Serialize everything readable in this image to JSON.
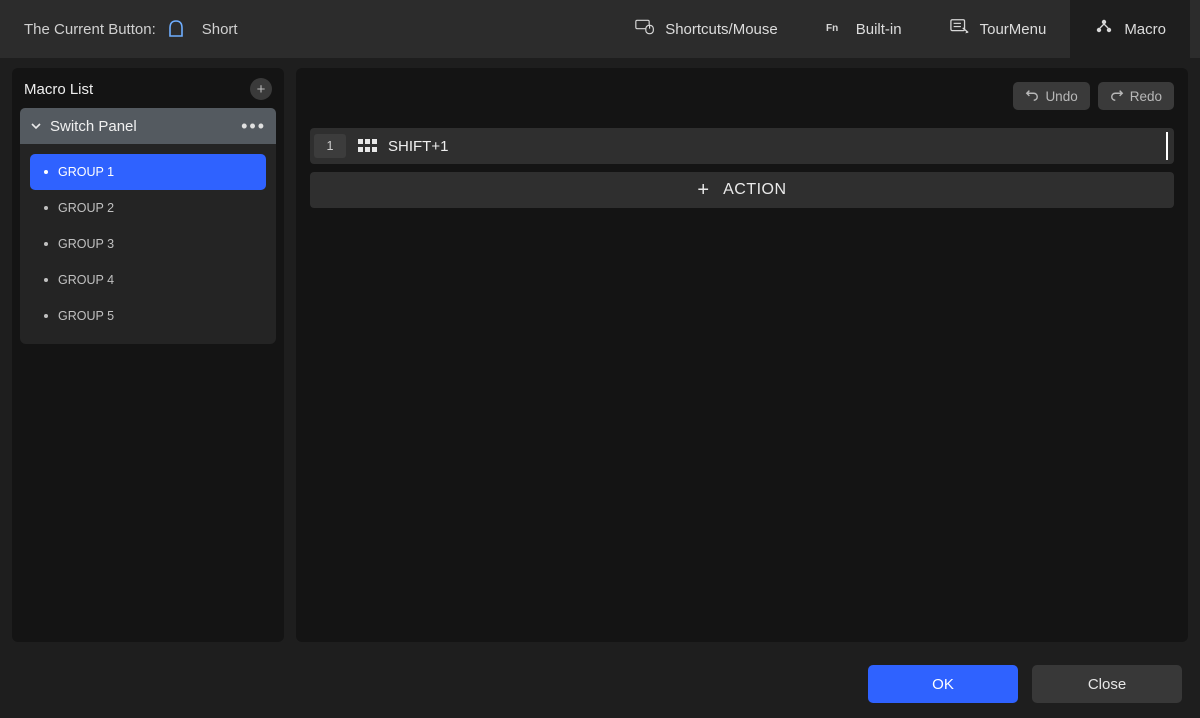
{
  "topbar": {
    "current_button_label": "The Current Button:",
    "current_button_value": "Short"
  },
  "tabs": {
    "shortcuts": "Shortcuts/Mouse",
    "builtin": "Built-in",
    "tourmenu": "TourMenu",
    "macro": "Macro"
  },
  "sidebar": {
    "title": "Macro List",
    "panel_title": "Switch Panel",
    "groups": [
      "GROUP 1",
      "GROUP 2",
      "GROUP 3",
      "GROUP 4",
      "GROUP 5"
    ],
    "active_index": 0
  },
  "toolbar": {
    "undo": "Undo",
    "redo": "Redo"
  },
  "actions": {
    "rows": [
      {
        "index": "1",
        "label": "SHIFT+1"
      }
    ],
    "add_label": "ACTION"
  },
  "footer": {
    "ok": "OK",
    "close": "Close"
  }
}
